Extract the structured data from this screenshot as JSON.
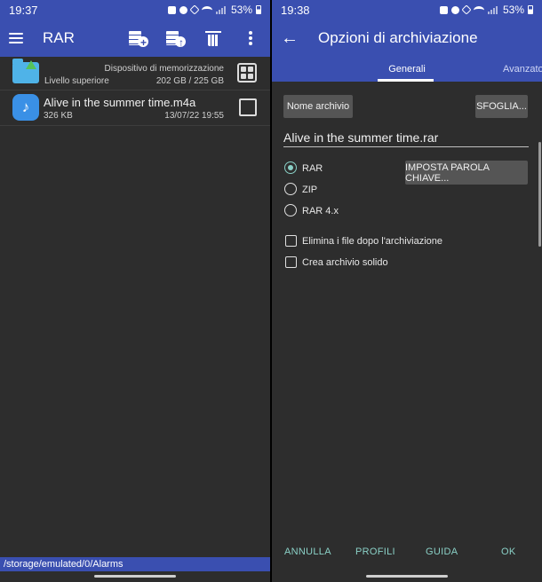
{
  "left": {
    "status": {
      "time": "19:37",
      "battery": "53%"
    },
    "appbar": {
      "title": "RAR"
    },
    "parent_row": {
      "label": "Livello superiore",
      "storage_label": "Dispositivo di memorizzazione",
      "storage_size": "202 GB / 225 GB"
    },
    "file": {
      "name": "Alive in the summer time.m4a",
      "size": "326 KB",
      "date": "13/07/22 19:55",
      "checked": false
    },
    "path": "/storage/emulated/0/Alarms"
  },
  "right": {
    "status": {
      "time": "19:38",
      "battery": "53%"
    },
    "appbar": {
      "title": "Opzioni di archiviazione"
    },
    "tabs": {
      "general": "Generali",
      "advanced": "Avanzato"
    },
    "archive_name_button": "Nome archivio",
    "browse_button": "SFOGLIA...",
    "archive_name_value": "Alive in the summer time.rar",
    "password_button": "IMPOSTA PAROLA CHIAVE...",
    "formats": [
      {
        "label": "RAR",
        "selected": true
      },
      {
        "label": "ZIP",
        "selected": false
      },
      {
        "label": "RAR 4.x",
        "selected": false
      }
    ],
    "options": [
      {
        "label": "Elimina i file dopo l'archiviazione",
        "checked": false
      },
      {
        "label": "Crea archivio solido",
        "checked": false
      }
    ],
    "actions": {
      "cancel": "ANNULLA",
      "profiles": "PROFILI",
      "help": "GUIDA",
      "ok": "OK"
    }
  },
  "colors": {
    "primary": "#3a4fb0",
    "background": "#2d2d2d",
    "accent": "#8ad0c6",
    "button": "#555555"
  },
  "icons": [
    "menu-icon",
    "archive-add-icon",
    "archive-extract-icon",
    "trash-icon",
    "more-vert-icon",
    "folder-up-icon",
    "grid-view-icon",
    "music-file-icon",
    "back-arrow-icon"
  ]
}
